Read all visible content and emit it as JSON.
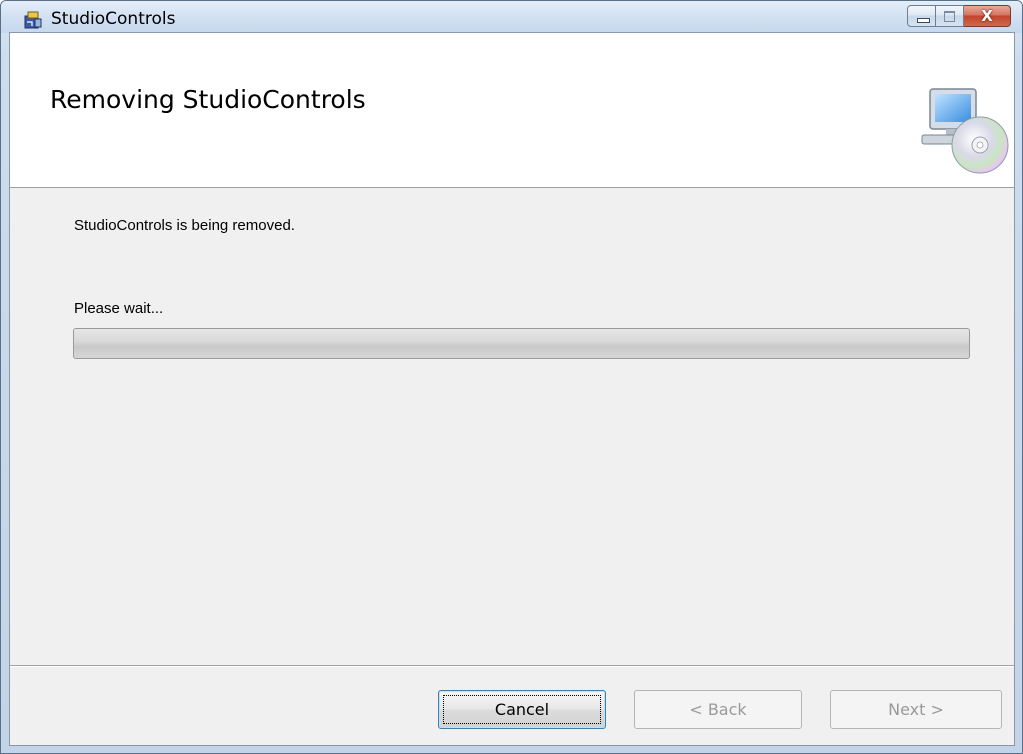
{
  "window": {
    "title": "StudioControls",
    "icon": "installer-package-icon"
  },
  "caption": {
    "minimize_icon": "minimize-icon",
    "maximize_icon": "maximize-icon",
    "close_glyph": "X"
  },
  "banner": {
    "title": "Removing StudioControls",
    "icon": "computer-disc-icon"
  },
  "body": {
    "status": "StudioControls is being removed.",
    "wait": "Please wait..."
  },
  "progress": {
    "value": 0
  },
  "buttons": {
    "cancel": "Cancel",
    "back": "< Back",
    "next": "Next >"
  },
  "colors": {
    "client_bg": "#f0f0f0",
    "banner_bg": "#ffffff",
    "close_red": "#c1432b"
  }
}
